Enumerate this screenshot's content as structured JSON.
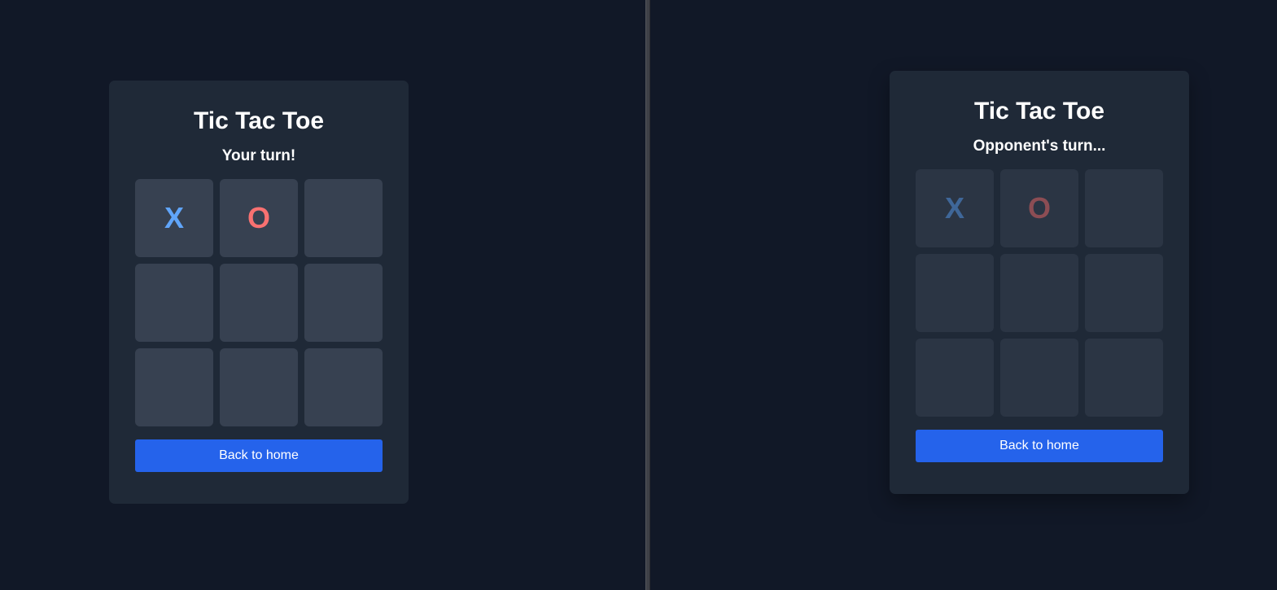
{
  "left": {
    "title": "Tic Tac Toe",
    "status": "Your turn!",
    "board": [
      "X",
      "O",
      "",
      "",
      "",
      "",
      "",
      "",
      ""
    ],
    "back_label": "Back to home"
  },
  "right": {
    "title": "Tic Tac Toe",
    "status": "Opponent's turn...",
    "board": [
      "X",
      "O",
      "",
      "",
      "",
      "",
      "",
      "",
      ""
    ],
    "back_label": "Back to home"
  },
  "colors": {
    "background": "#111827",
    "card": "#1f2937",
    "cell": "#374151",
    "x_mark": "#60a5fa",
    "o_mark": "#f87171",
    "button": "#2563eb"
  }
}
